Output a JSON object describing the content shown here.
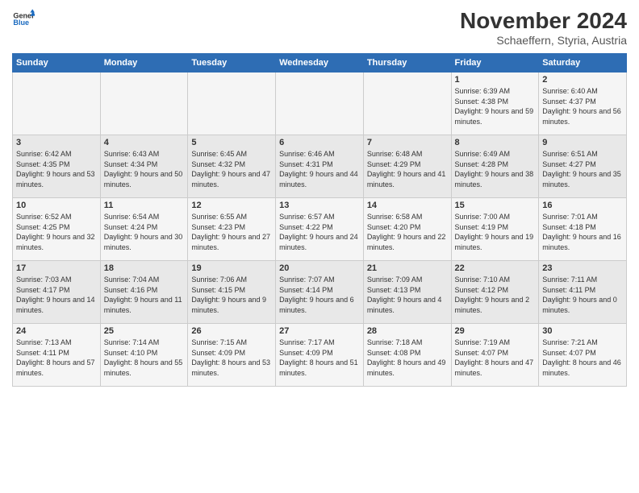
{
  "logo": {
    "line1": "General",
    "line2": "Blue"
  },
  "title": "November 2024",
  "subtitle": "Schaeffern, Styria, Austria",
  "days_of_week": [
    "Sunday",
    "Monday",
    "Tuesday",
    "Wednesday",
    "Thursday",
    "Friday",
    "Saturday"
  ],
  "weeks": [
    [
      {
        "day": "",
        "info": ""
      },
      {
        "day": "",
        "info": ""
      },
      {
        "day": "",
        "info": ""
      },
      {
        "day": "",
        "info": ""
      },
      {
        "day": "",
        "info": ""
      },
      {
        "day": "1",
        "info": "Sunrise: 6:39 AM\nSunset: 4:38 PM\nDaylight: 9 hours and 59 minutes."
      },
      {
        "day": "2",
        "info": "Sunrise: 6:40 AM\nSunset: 4:37 PM\nDaylight: 9 hours and 56 minutes."
      }
    ],
    [
      {
        "day": "3",
        "info": "Sunrise: 6:42 AM\nSunset: 4:35 PM\nDaylight: 9 hours and 53 minutes."
      },
      {
        "day": "4",
        "info": "Sunrise: 6:43 AM\nSunset: 4:34 PM\nDaylight: 9 hours and 50 minutes."
      },
      {
        "day": "5",
        "info": "Sunrise: 6:45 AM\nSunset: 4:32 PM\nDaylight: 9 hours and 47 minutes."
      },
      {
        "day": "6",
        "info": "Sunrise: 6:46 AM\nSunset: 4:31 PM\nDaylight: 9 hours and 44 minutes."
      },
      {
        "day": "7",
        "info": "Sunrise: 6:48 AM\nSunset: 4:29 PM\nDaylight: 9 hours and 41 minutes."
      },
      {
        "day": "8",
        "info": "Sunrise: 6:49 AM\nSunset: 4:28 PM\nDaylight: 9 hours and 38 minutes."
      },
      {
        "day": "9",
        "info": "Sunrise: 6:51 AM\nSunset: 4:27 PM\nDaylight: 9 hours and 35 minutes."
      }
    ],
    [
      {
        "day": "10",
        "info": "Sunrise: 6:52 AM\nSunset: 4:25 PM\nDaylight: 9 hours and 32 minutes."
      },
      {
        "day": "11",
        "info": "Sunrise: 6:54 AM\nSunset: 4:24 PM\nDaylight: 9 hours and 30 minutes."
      },
      {
        "day": "12",
        "info": "Sunrise: 6:55 AM\nSunset: 4:23 PM\nDaylight: 9 hours and 27 minutes."
      },
      {
        "day": "13",
        "info": "Sunrise: 6:57 AM\nSunset: 4:22 PM\nDaylight: 9 hours and 24 minutes."
      },
      {
        "day": "14",
        "info": "Sunrise: 6:58 AM\nSunset: 4:20 PM\nDaylight: 9 hours and 22 minutes."
      },
      {
        "day": "15",
        "info": "Sunrise: 7:00 AM\nSunset: 4:19 PM\nDaylight: 9 hours and 19 minutes."
      },
      {
        "day": "16",
        "info": "Sunrise: 7:01 AM\nSunset: 4:18 PM\nDaylight: 9 hours and 16 minutes."
      }
    ],
    [
      {
        "day": "17",
        "info": "Sunrise: 7:03 AM\nSunset: 4:17 PM\nDaylight: 9 hours and 14 minutes."
      },
      {
        "day": "18",
        "info": "Sunrise: 7:04 AM\nSunset: 4:16 PM\nDaylight: 9 hours and 11 minutes."
      },
      {
        "day": "19",
        "info": "Sunrise: 7:06 AM\nSunset: 4:15 PM\nDaylight: 9 hours and 9 minutes."
      },
      {
        "day": "20",
        "info": "Sunrise: 7:07 AM\nSunset: 4:14 PM\nDaylight: 9 hours and 6 minutes."
      },
      {
        "day": "21",
        "info": "Sunrise: 7:09 AM\nSunset: 4:13 PM\nDaylight: 9 hours and 4 minutes."
      },
      {
        "day": "22",
        "info": "Sunrise: 7:10 AM\nSunset: 4:12 PM\nDaylight: 9 hours and 2 minutes."
      },
      {
        "day": "23",
        "info": "Sunrise: 7:11 AM\nSunset: 4:11 PM\nDaylight: 9 hours and 0 minutes."
      }
    ],
    [
      {
        "day": "24",
        "info": "Sunrise: 7:13 AM\nSunset: 4:11 PM\nDaylight: 8 hours and 57 minutes."
      },
      {
        "day": "25",
        "info": "Sunrise: 7:14 AM\nSunset: 4:10 PM\nDaylight: 8 hours and 55 minutes."
      },
      {
        "day": "26",
        "info": "Sunrise: 7:15 AM\nSunset: 4:09 PM\nDaylight: 8 hours and 53 minutes."
      },
      {
        "day": "27",
        "info": "Sunrise: 7:17 AM\nSunset: 4:09 PM\nDaylight: 8 hours and 51 minutes."
      },
      {
        "day": "28",
        "info": "Sunrise: 7:18 AM\nSunset: 4:08 PM\nDaylight: 8 hours and 49 minutes."
      },
      {
        "day": "29",
        "info": "Sunrise: 7:19 AM\nSunset: 4:07 PM\nDaylight: 8 hours and 47 minutes."
      },
      {
        "day": "30",
        "info": "Sunrise: 7:21 AM\nSunset: 4:07 PM\nDaylight: 8 hours and 46 minutes."
      }
    ]
  ]
}
